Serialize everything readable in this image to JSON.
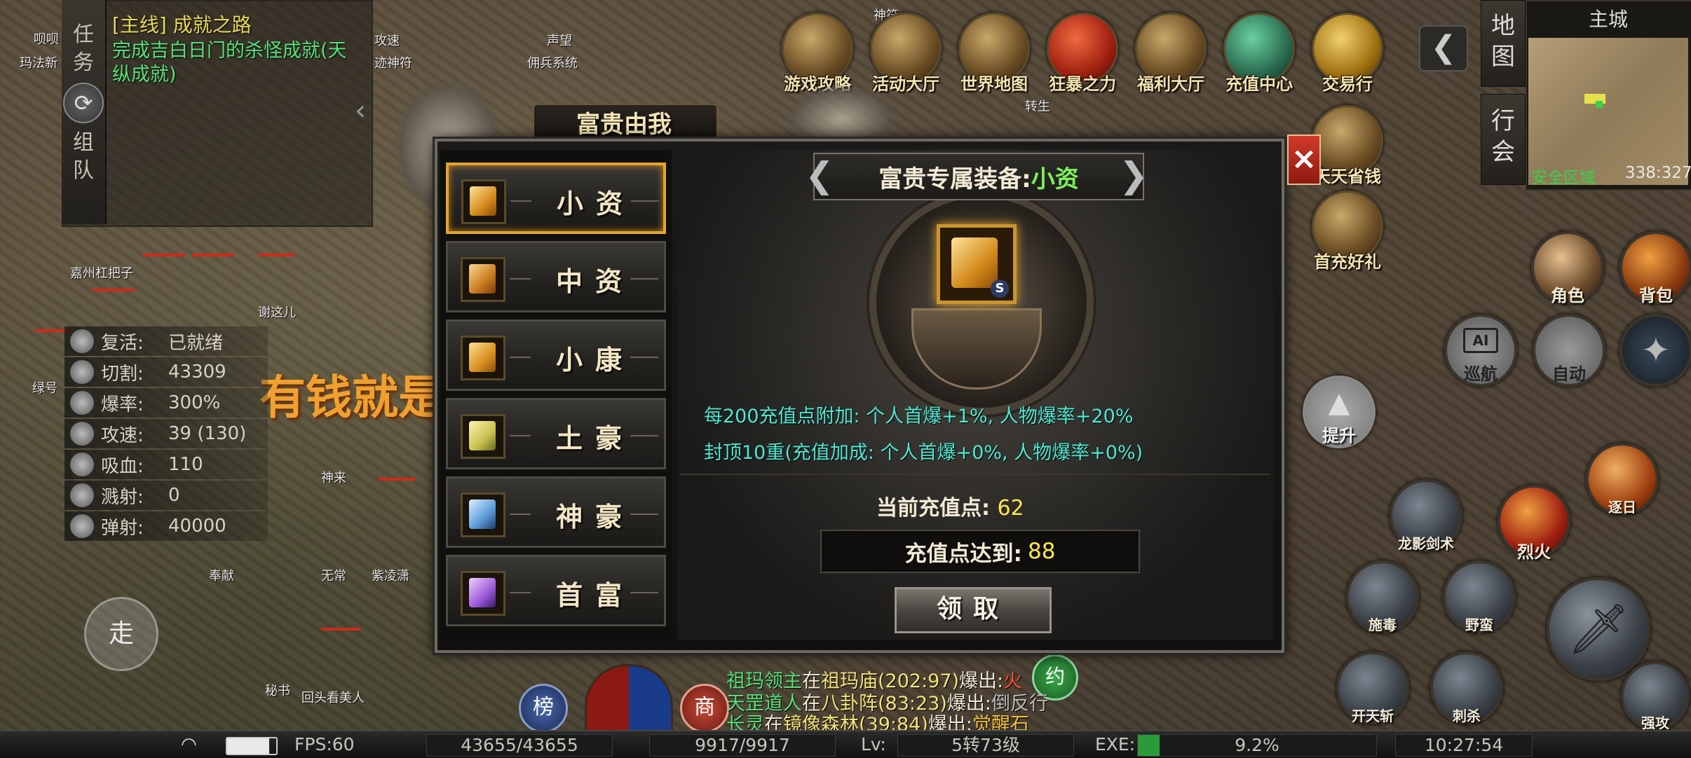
{
  "quest": {
    "tab_labels": [
      "任",
      "务",
      "组",
      "队"
    ],
    "title": "[主线] 成就之路",
    "desc": "完成吉白日门的杀怪成就(天纵成就)"
  },
  "top_icons": [
    {
      "label": "游戏攻略",
      "icon": "guide-icon"
    },
    {
      "label": "活动大厅",
      "icon": "activity-icon"
    },
    {
      "label": "世界地图",
      "icon": "world-map-icon"
    },
    {
      "label": "狂暴之力",
      "icon": "rage-icon"
    },
    {
      "label": "福利大厅",
      "icon": "welfare-icon"
    },
    {
      "label": "充值中心",
      "icon": "recharge-icon"
    },
    {
      "label": "交易行",
      "icon": "trade-icon"
    }
  ],
  "side_icons": [
    {
      "label": "天天省钱",
      "icon": "save-money-icon"
    },
    {
      "label": "首充好礼",
      "icon": "first-recharge-icon"
    }
  ],
  "minimap": {
    "title": "主城",
    "zone": "安全区域",
    "coords": "338:327",
    "tabs": [
      "地",
      "图",
      "行",
      "会"
    ],
    "back_icon": "back-arrow-icon"
  },
  "stats": [
    {
      "key": "复活:",
      "value": "已就绪",
      "icon": "revive-icon"
    },
    {
      "key": "切割:",
      "value": "43309",
      "icon": "cut-icon"
    },
    {
      "key": "爆率:",
      "value": "300%",
      "icon": "droprate-icon"
    },
    {
      "key": "攻速:",
      "value": "39 (130)",
      "icon": "attack-speed-icon"
    },
    {
      "key": "吸血:",
      "value": "110",
      "icon": "lifesteal-icon"
    },
    {
      "key": "溅射:",
      "value": "0",
      "icon": "splash-icon"
    },
    {
      "key": "弹射:",
      "value": "40000",
      "icon": "bounce-icon"
    }
  ],
  "dialog": {
    "title": "富贵由我",
    "close": "×",
    "tiers": [
      {
        "label": "小资",
        "color": "#f0c060"
      },
      {
        "label": "中资",
        "color": "#e8a040"
      },
      {
        "label": "小康",
        "color": "#f0b040"
      },
      {
        "label": "土豪",
        "color": "#d8d060"
      },
      {
        "label": "神豪",
        "color": "#7ab8e8"
      },
      {
        "label": "首富",
        "color": "#b070e0"
      }
    ],
    "banner_prefix": "富贵专属装备:",
    "banner_value": "小资",
    "desc_line1": "每200充值点附加: 个人首爆+1%, 人物爆率+20%",
    "desc_line2": "封顶10重(充值加成: 个人首爆+0%, 人物爆率+0%)",
    "current_label": "当前充值点:",
    "current_value": "62",
    "reach_label": "充值点达到:",
    "reach_value": "88",
    "claim_label": "领取",
    "emblem_badge": "S"
  },
  "right_buttons": [
    {
      "label": "角色",
      "icon": "character-icon"
    },
    {
      "label": "背包",
      "icon": "bag-icon"
    },
    {
      "label": "巡航",
      "icon": "ai-cruise-icon",
      "badge": "AI"
    },
    {
      "label": "自动",
      "icon": "auto-icon"
    },
    {
      "label": "提升",
      "icon": "upgrade-arrow-icon"
    }
  ],
  "skills": [
    {
      "label": "龙影剑术",
      "icon": "dragon-sword-icon"
    },
    {
      "label": "烈火",
      "icon": "blazing-fire-icon"
    },
    {
      "label": "逐日",
      "icon": "chase-sun-icon"
    },
    {
      "label": "施毒",
      "icon": "poison-icon"
    },
    {
      "label": "野蛮",
      "icon": "savage-charge-icon"
    },
    {
      "label": "开天斩",
      "icon": "sky-split-icon"
    },
    {
      "label": "刺杀",
      "icon": "assassinate-icon"
    },
    {
      "label": "强攻",
      "icon": "strong-attack-icon"
    }
  ],
  "walk_button": "走",
  "left_buttons": [
    {
      "label": "榜",
      "icon": "ranking-icon"
    },
    {
      "label": "商",
      "icon": "shop-icon"
    },
    {
      "label": "约",
      "icon": "appointment-icon"
    }
  ],
  "chat": [
    {
      "who": "祖玛领主",
      "verb": "在",
      "where": "祖玛庙(202:97)",
      "action": "爆出:",
      "item": "火"
    },
    {
      "who": "天罡道人",
      "verb": "在",
      "where": "八卦阵(83:23)",
      "action": "爆出:",
      "item": "倒反行"
    },
    {
      "who": "长灵",
      "verb": "在",
      "where": "镜像森林(39:84)",
      "action": "爆出:",
      "item": "觉醒石"
    }
  ],
  "bottom_bar": {
    "fps": "FPS:60",
    "hp": "43655/43655",
    "mp": "9917/9917",
    "lv_label": "Lv:",
    "lv": "5转73级",
    "exp_label": "EXE:",
    "exp": "9.2%",
    "exp_fraction": 0.092,
    "time": "10:27:54",
    "battery_fraction": 0.85
  },
  "world_names": [
    "呗呗",
    "玛法新",
    "攻速",
    "迹神符",
    "声望",
    "佣兵系统",
    "嘉州杠把子",
    "谢这儿",
    "绿号",
    "神来",
    "奉献",
    "无常",
    "紫凌潇",
    "秘书",
    "回头看美人",
    "神符",
    "转生"
  ],
  "banner_art": "有钱就是"
}
